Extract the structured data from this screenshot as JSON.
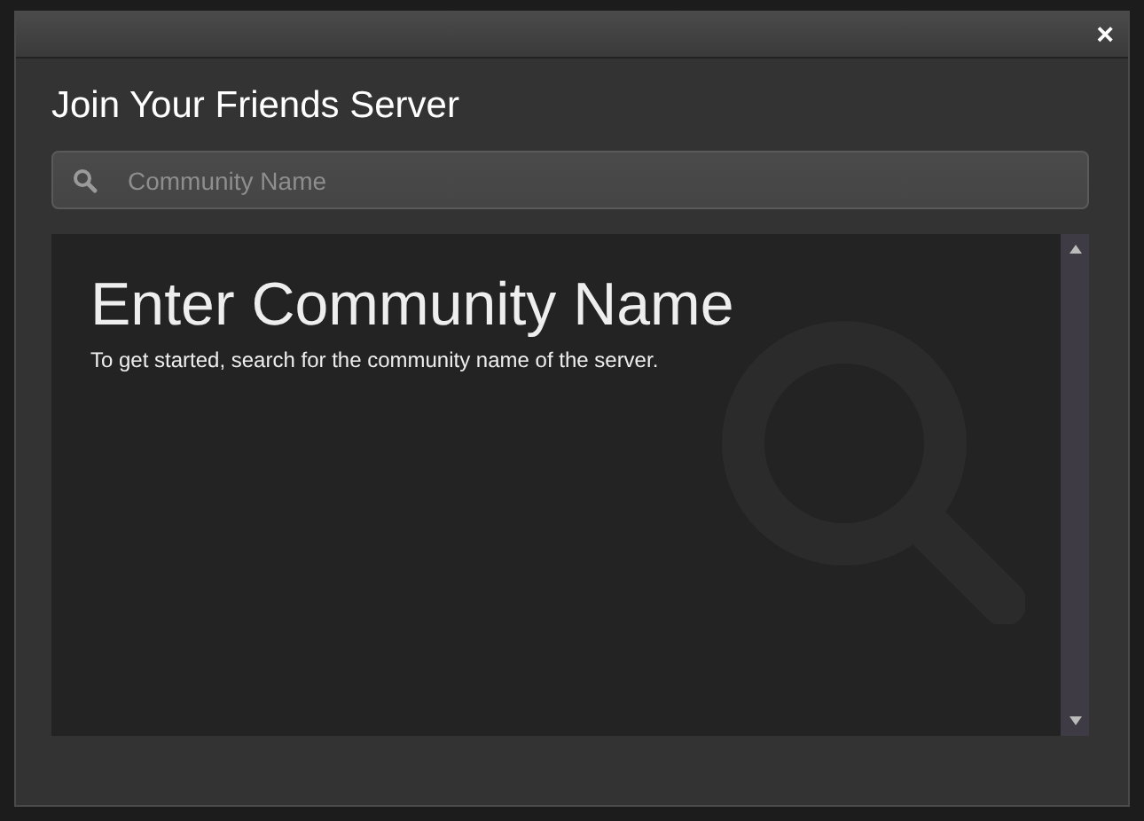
{
  "window": {
    "close_label": "×"
  },
  "title": "Join Your Friends Server",
  "search": {
    "placeholder": "Community Name"
  },
  "results": {
    "heading": "Enter Community Name",
    "hint": "To get started, search for the community name of the server."
  }
}
